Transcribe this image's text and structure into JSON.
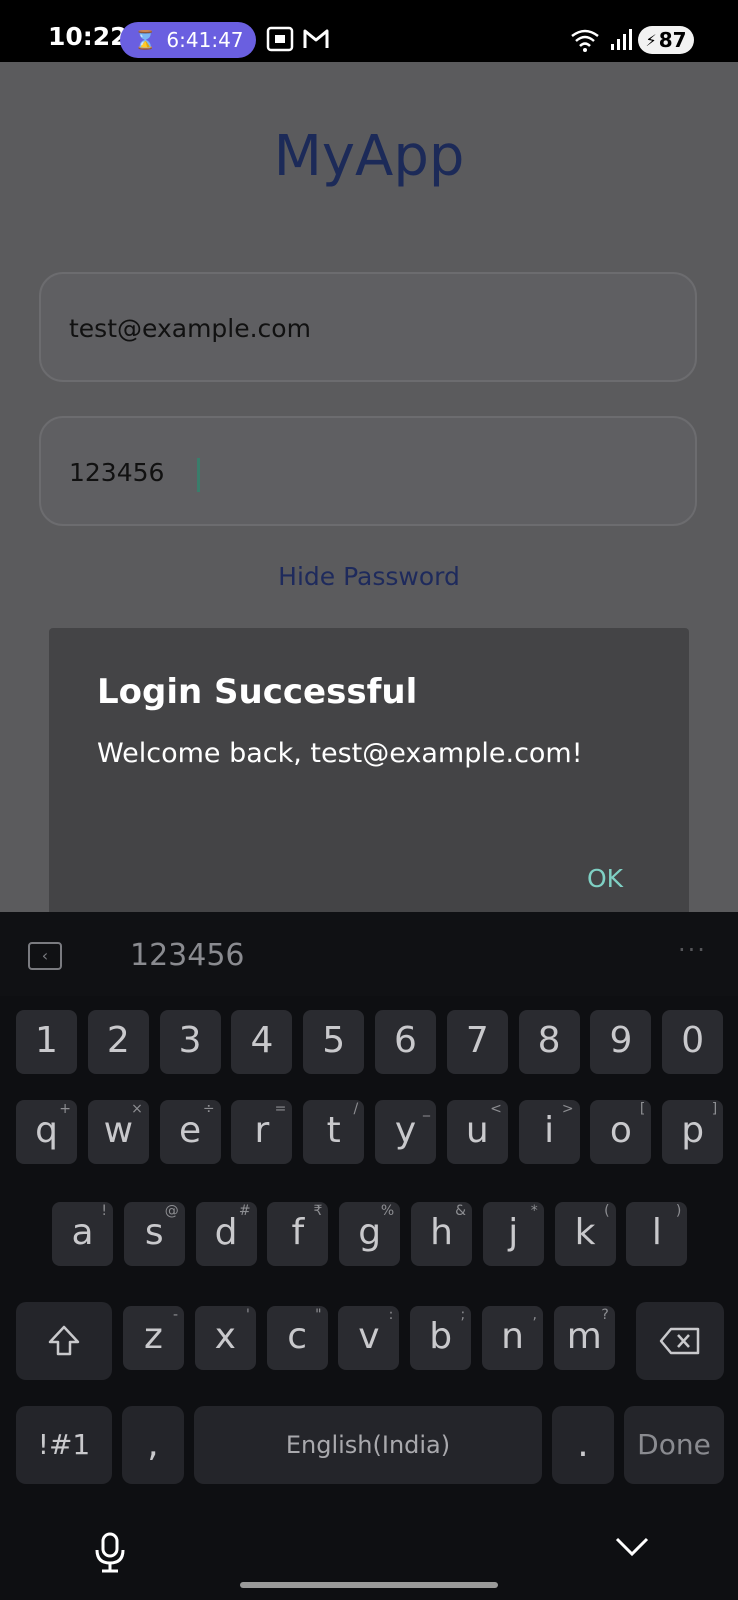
{
  "status_bar": {
    "time": "10:22",
    "timer": "6:41:47",
    "battery": "87",
    "wifi_label": "5"
  },
  "app": {
    "title": "MyApp",
    "email_value": "test@example.com",
    "password_value": "123456",
    "hide_password_label": "Hide Password"
  },
  "dialog": {
    "title": "Login Successful",
    "message": "Welcome back, test@example.com!",
    "ok_label": "OK"
  },
  "keyboard": {
    "suggestion": "123456",
    "number_row": [
      "1",
      "2",
      "3",
      "4",
      "5",
      "6",
      "7",
      "8",
      "9",
      "0"
    ],
    "row1": [
      {
        "k": "q",
        "s": "+"
      },
      {
        "k": "w",
        "s": "×"
      },
      {
        "k": "e",
        "s": "÷"
      },
      {
        "k": "r",
        "s": "="
      },
      {
        "k": "t",
        "s": "/"
      },
      {
        "k": "y",
        "s": "_"
      },
      {
        "k": "u",
        "s": "<"
      },
      {
        "k": "i",
        "s": ">"
      },
      {
        "k": "o",
        "s": "["
      },
      {
        "k": "p",
        "s": "]"
      }
    ],
    "row2": [
      {
        "k": "a",
        "s": "!"
      },
      {
        "k": "s",
        "s": "@"
      },
      {
        "k": "d",
        "s": "#"
      },
      {
        "k": "f",
        "s": "₹"
      },
      {
        "k": "g",
        "s": "%"
      },
      {
        "k": "h",
        "s": "&"
      },
      {
        "k": "j",
        "s": "*"
      },
      {
        "k": "k",
        "s": "("
      },
      {
        "k": "l",
        "s": ")"
      }
    ],
    "row3": [
      {
        "k": "z",
        "s": "-"
      },
      {
        "k": "x",
        "s": "'"
      },
      {
        "k": "c",
        "s": "\""
      },
      {
        "k": "v",
        "s": ":"
      },
      {
        "k": "b",
        "s": ";"
      },
      {
        "k": "n",
        "s": ","
      },
      {
        "k": "m",
        "s": "?"
      }
    ],
    "symbols_label": "!#1",
    "comma_label": ",",
    "space_label": "English(India)",
    "period_label": ".",
    "done_label": "Done"
  }
}
